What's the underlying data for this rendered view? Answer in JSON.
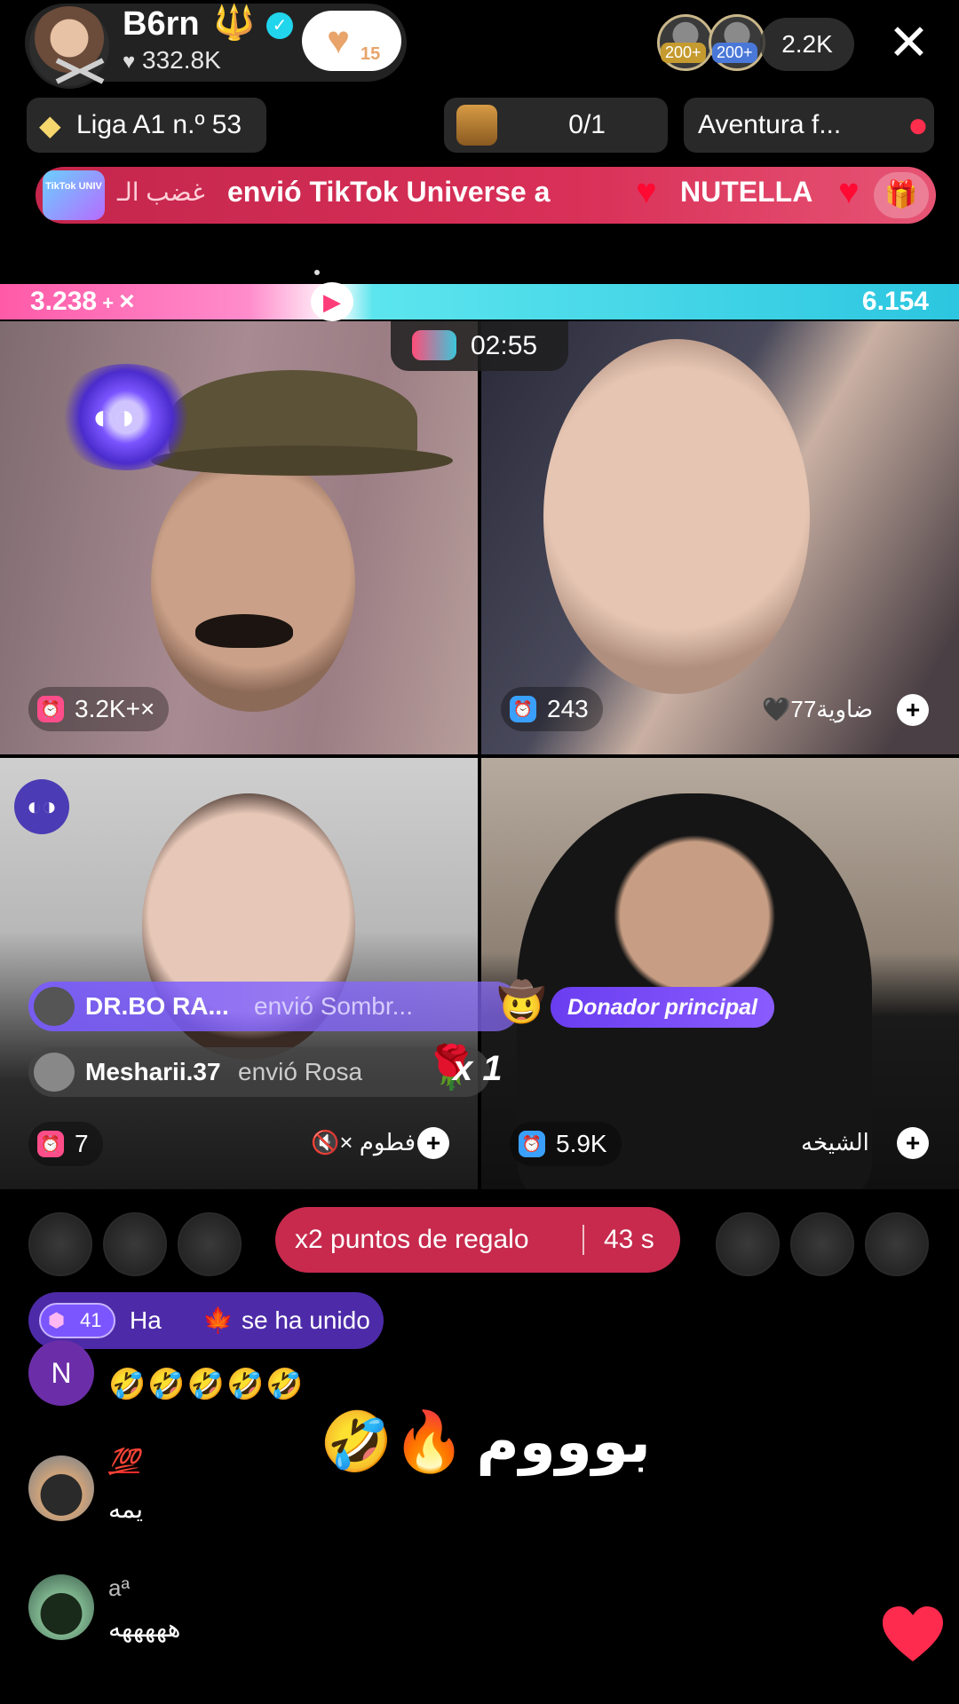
{
  "header": {
    "host_name": "B6rn",
    "trident": "🔱",
    "likes": "332.8K",
    "follow_badge_count": "15",
    "viewer_tags": [
      "200+",
      "200+"
    ],
    "viewer_count": "2.2K",
    "close_icon": "✕"
  },
  "league": {
    "label": "Liga A1 n.º 53"
  },
  "score": {
    "value": "0/1"
  },
  "adventure": {
    "label": "Aventura f..."
  },
  "gift_banner": {
    "badge": "TikTok UNIV",
    "sender_arabic": "غضب الـ",
    "message": "envió TikTok Universe a",
    "recipient": "NUTELLA"
  },
  "battle": {
    "left_score": "3.238",
    "left_multiplier": "×",
    "right_score": "6.154",
    "mid_icon": "▶"
  },
  "timer": {
    "value": "02:55"
  },
  "tiles": [
    {
      "stat": "3.2K+",
      "stat_suffix": "×",
      "name": ""
    },
    {
      "stat": "243",
      "name": "77ضاوية",
      "name_heart": "🖤"
    },
    {
      "stat": "7",
      "name": "فطوم",
      "name_prefix": "🔇×"
    },
    {
      "stat": "5.9K",
      "name": "الشيخه"
    }
  ],
  "gift_strips": [
    {
      "name": "DR.BO RA...",
      "action": "envió  Sombr...",
      "icon": "🤠"
    },
    {
      "name": "Mesharii.37",
      "action": "envió  Rosa",
      "icon": "🌹",
      "combo": "x 1"
    }
  ],
  "top_donor": {
    "label": "Donador principal"
  },
  "points": {
    "label": "x2 puntos de regalo",
    "seconds": "43 s"
  },
  "join": {
    "level": "41",
    "name": "Ha",
    "fire": "🍁",
    "text": "se ha unido"
  },
  "comments": [
    {
      "avatar_letter": "N",
      "name": "",
      "text": "🤣🤣🤣🤣🤣"
    },
    {
      "name": "💯",
      "text": "يمه"
    },
    {
      "name": "aª",
      "text": "هههههه"
    }
  ],
  "caption": {
    "text": "بوووم",
    "emojis": "🤣🔥"
  },
  "colors": {
    "gift_banner": "#d93058",
    "points_pill": "#c72a4d",
    "join_pill": "#4d2ba8",
    "battle_pink": "#ff5aa8",
    "battle_cyan": "#2cc6e0"
  }
}
